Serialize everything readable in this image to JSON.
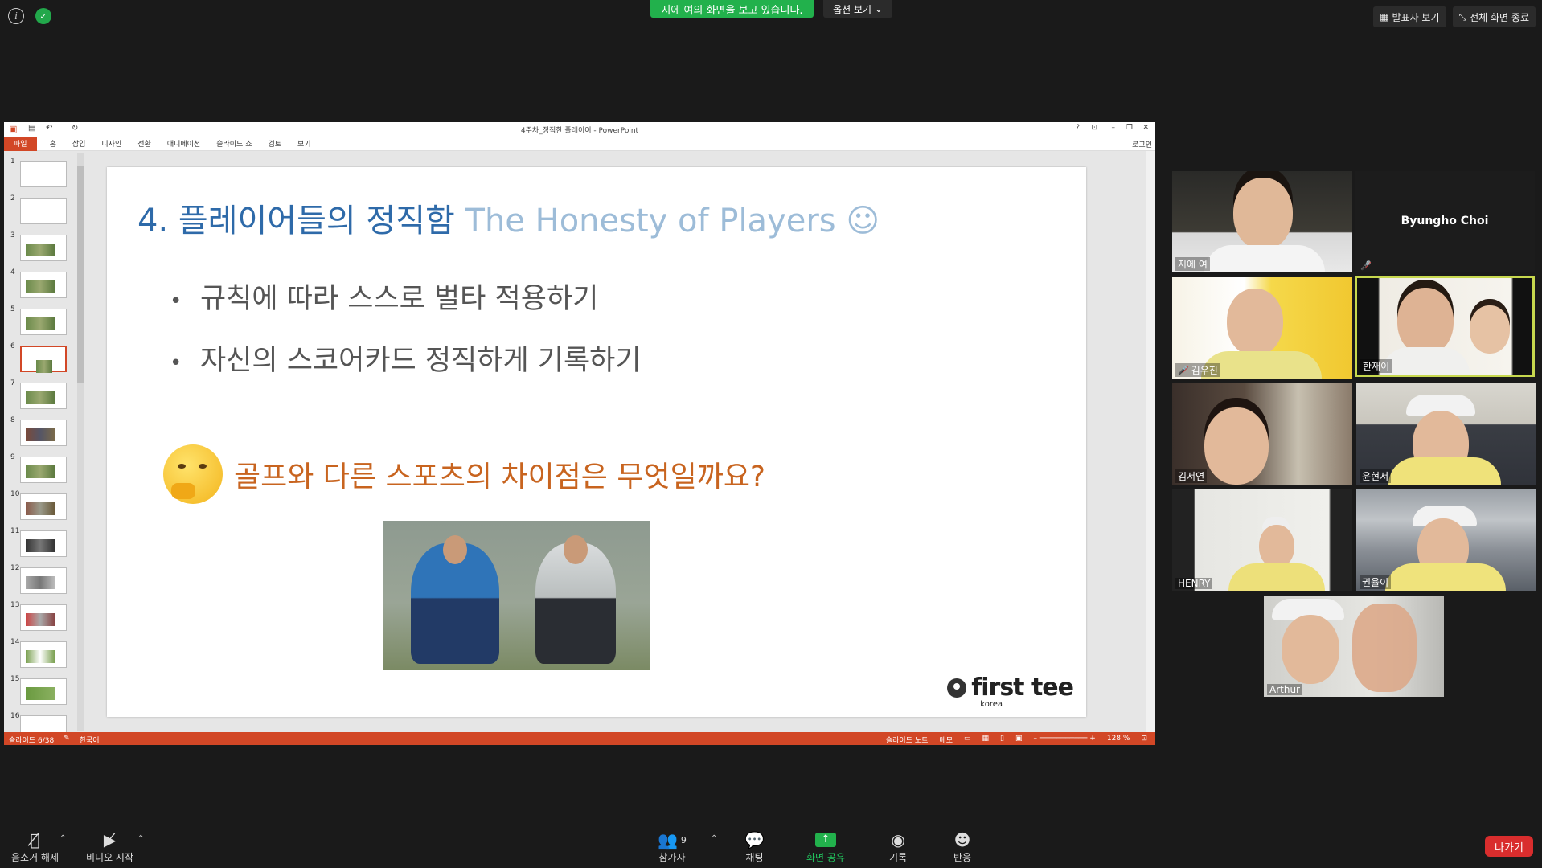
{
  "zoom": {
    "share_banner": "지에 여의 화면을 보고 있습니다.",
    "options_label": "옵션 보기",
    "speaker_view_label": "발표자 보기",
    "exit_fullscreen_label": "전체 화면 종료",
    "colors": {
      "share_green": "#22b14c",
      "leave_red": "#d92d2d",
      "active_speaker": "#c7d84e"
    }
  },
  "ppt": {
    "window_title": "4주차_정직한 플레이어 - PowerPoint",
    "signin": "로그인",
    "tabs": [
      "파일",
      "홈",
      "삽입",
      "디자인",
      "전환",
      "애니메이션",
      "슬라이드 쇼",
      "검토",
      "보기"
    ],
    "thumbnail_numbers": [
      "1",
      "2",
      "3",
      "4",
      "5",
      "6",
      "7",
      "8",
      "9",
      "10",
      "11",
      "12",
      "13",
      "14",
      "15",
      "16"
    ],
    "selected_slide": 6,
    "status": {
      "slide_position": "슬라이드 6/38",
      "language": "한국어",
      "notes": "슬라이드 노트",
      "comments": "메모",
      "zoom": "128 %"
    },
    "colors": {
      "accent": "#d24726"
    }
  },
  "slide": {
    "title_ko": "4. 플레이어들의 정직함",
    "title_en": "The Honesty of Players ☺",
    "bullets": [
      "규칙에 따라 스스로 벌타 적용하기",
      "자신의 스코어카드 정직하게 기록하기"
    ],
    "question": "골프와 다른 스포츠의 차이점은 무엇일까요?",
    "logo_main": "first tee",
    "logo_sub": "korea"
  },
  "participants": [
    {
      "name": "지에 여",
      "muted": false
    },
    {
      "name": "Byungho Choi",
      "muted": true
    },
    {
      "name": "김우진",
      "muted": true
    },
    {
      "name": "한재이",
      "muted": false
    },
    {
      "name": "김서연",
      "muted": false
    },
    {
      "name": "윤현서",
      "muted": false
    },
    {
      "name": "HENRY",
      "muted": false
    },
    {
      "name": "권율이",
      "muted": false
    },
    {
      "name": "Arthur",
      "muted": false
    }
  ],
  "toolbar": {
    "unmute": "음소거 해제",
    "start_video": "비디오 시작",
    "participants": "참가자",
    "participants_count": "9",
    "chat": "채팅",
    "share_screen": "화면 공유",
    "record": "기록",
    "reactions": "반응",
    "leave": "나가기"
  }
}
